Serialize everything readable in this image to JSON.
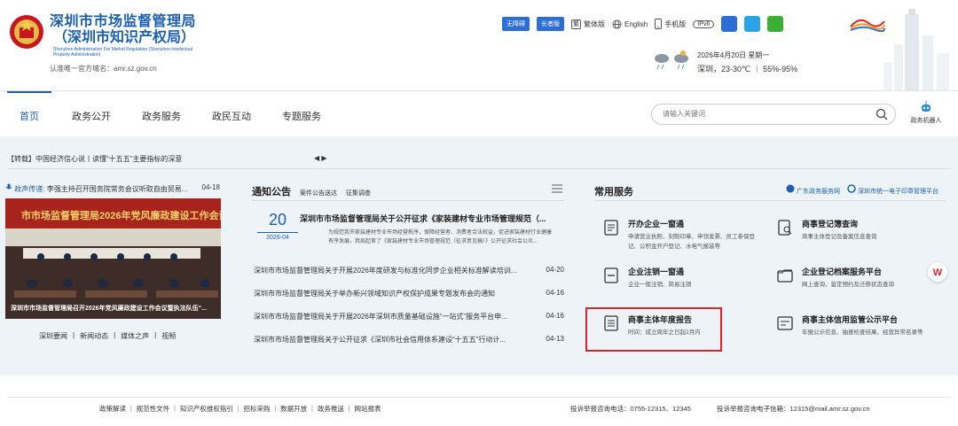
{
  "header": {
    "title_line1": "深圳市市场监督管理局",
    "title_line2": "（深圳市知识产权局）",
    "title_en": "Shenzhen Administration For Market Regulation (Shenzhen Intellectual Property Administration)",
    "domain": "认准唯一官方域名：amr.sz.gov.cn",
    "topbar": {
      "barrier_free": "无障碍",
      "elder_version": "长者版",
      "traditional": "繁体版",
      "english": "English",
      "mobile": "手机版",
      "ipv6": "IPv6"
    },
    "weather": {
      "date": "2026年4月20日 星期一",
      "info": "深圳，23-30℃  ｜ 55%-95%"
    }
  },
  "nav": {
    "items": [
      "首页",
      "政务公开",
      "政务服务",
      "政民互动",
      "专题服务"
    ],
    "search_placeholder": "请输入关键词",
    "robot_label": "政务机器人"
  },
  "ticker": {
    "text": "【转载】中国经济信心说丨读懂“十五五”主要指标的深意",
    "arrows": "◀ ▶"
  },
  "left": {
    "voice_label": "政声传递:",
    "voice_text": "李强主持召开国务院常务会议听取自由贸易...",
    "voice_date": "04-18",
    "banner_text": "市市场监督管理局2026年党风廉政建设工作会议",
    "photo_caption": "深圳市市场监督管理局召开2026年党风廉政建设工作会议暨执法队伍“...",
    "tabs": [
      "深圳要闻",
      "新闻动态",
      "媒体之声",
      "视频"
    ],
    "tab_sep": "|"
  },
  "notice": {
    "title": "通知公告",
    "tabs": [
      "案件公告送达",
      "征集调查"
    ],
    "feature": {
      "day": "20",
      "month": "2026-04",
      "title": "深圳市市场监督管理局关于公开征求《家装建材专业市场管理规范（...",
      "desc": "为规范我市家装建材专业市场经营秩序，保障经营者、消费者合法权益，促进家装建材行业健康有序发展，我局起草了《家装建材专业市场管理规范（征求意见稿）》公开征求社会公众..."
    },
    "items": [
      {
        "title": "深圳市市场监督管理局关于开展2026年度研发与标准化同步企业相关标准解读培训...",
        "date": "04-20"
      },
      {
        "title": "深圳市市场监督管理局关于举办新兴领域知识产权保护成果专题发布会的通知",
        "date": "04-16"
      },
      {
        "title": "深圳市市场监督管理局关于开展2026年深圳市质量基础设施“一站式”服务平台申...",
        "date": "04-16"
      },
      {
        "title": "深圳市市场监督管理局关于公开征求《深圳市社会信用体系建设“十五五”行动计...",
        "date": "04-13"
      }
    ]
  },
  "services": {
    "title": "常用服务",
    "links": [
      "广东政务服务网",
      "深圳市统一电子印章管理平台"
    ],
    "cards": [
      {
        "name": "开办企业一窗通",
        "desc": "申请营业执照、刻制印章、申领发票、员工参保登记、公积金开户登记、水电气报装等"
      },
      {
        "name": "商事登记簿查询",
        "desc": "商事主体登记及备案信息查询"
      },
      {
        "name": "企业注销一窗通",
        "desc": "企业一般注销、简易注销"
      },
      {
        "name": "企业登记档案服务平台",
        "desc": "网上查询、鉴定预约及迁移状态查询"
      },
      {
        "name": "商事主体年度报告",
        "desc": "时间：成立周年之日起2月内"
      },
      {
        "name": "商事主体信用监管公示平台",
        "desc": "年报公示信息、抽查检查结果、经营异常名录等"
      }
    ]
  },
  "footer": {
    "links": "政策解读 ｜ 规范性文件 ｜ 知识产权维权指引 ｜ 招标采购 ｜ 数据开放 ｜ 政务推送 ｜ 网站报表",
    "phone": "投诉举报咨询电话：0755-12315、12345",
    "mail": "投诉举报咨询电子信箱：12315@mail.amr.sz.gov.cn"
  },
  "colors": {
    "brand_blue": "#1a5fb4",
    "highlight_red": "#e0232a",
    "panel_bg": "#eef3f8"
  }
}
